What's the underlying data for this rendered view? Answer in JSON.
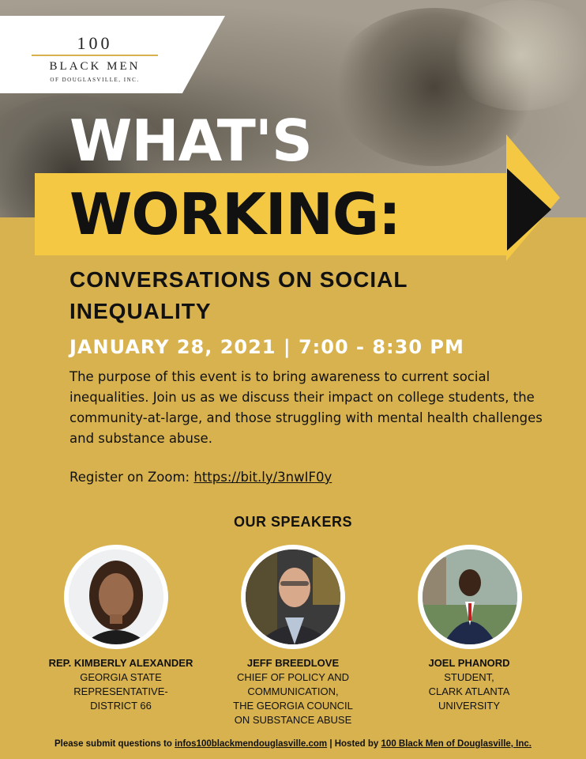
{
  "logo": {
    "number": "100",
    "name": "BLACK MEN",
    "sub": "OF DOUGLASVILLE, INC."
  },
  "headline": {
    "line1": "WHAT'S",
    "line2": "WORKING:"
  },
  "subtitle": "CONVERSATIONS ON SOCIAL INEQUALITY",
  "date": "JANUARY 28, 2021 | 7:00 - 8:30 PM",
  "description": "The purpose of this event is to bring awareness to current social inequalities. Join us as we discuss their impact on college students, the community-at-large, and those struggling with mental health challenges and substance abuse.",
  "register": {
    "label": "Register on Zoom: ",
    "link": "https://bit.ly/3nwIF0y"
  },
  "speakers_heading": "OUR SPEAKERS",
  "speakers": [
    {
      "name": "REP. KIMBERLY ALEXANDER",
      "role": "GEORGIA STATE\nREPRESENTATIVE-\nDISTRICT 66"
    },
    {
      "name": "JEFF BREEDLOVE",
      "role": "CHIEF OF POLICY AND\nCOMMUNICATION,\nTHE GEORGIA COUNCIL\nON SUBSTANCE ABUSE"
    },
    {
      "name": "JOEL PHANORD",
      "role": "STUDENT,\nCLARK ATLANTA\nUNIVERSITY"
    }
  ],
  "footer": {
    "prefix": "Please submit questions to ",
    "email": "infos100blackmendouglasville.com",
    "middle": " | Hosted by ",
    "host": "100 Black Men of Douglasville, Inc."
  },
  "colors": {
    "background": "#d7b24f",
    "accent": "#f4c842",
    "dark": "#111111"
  }
}
